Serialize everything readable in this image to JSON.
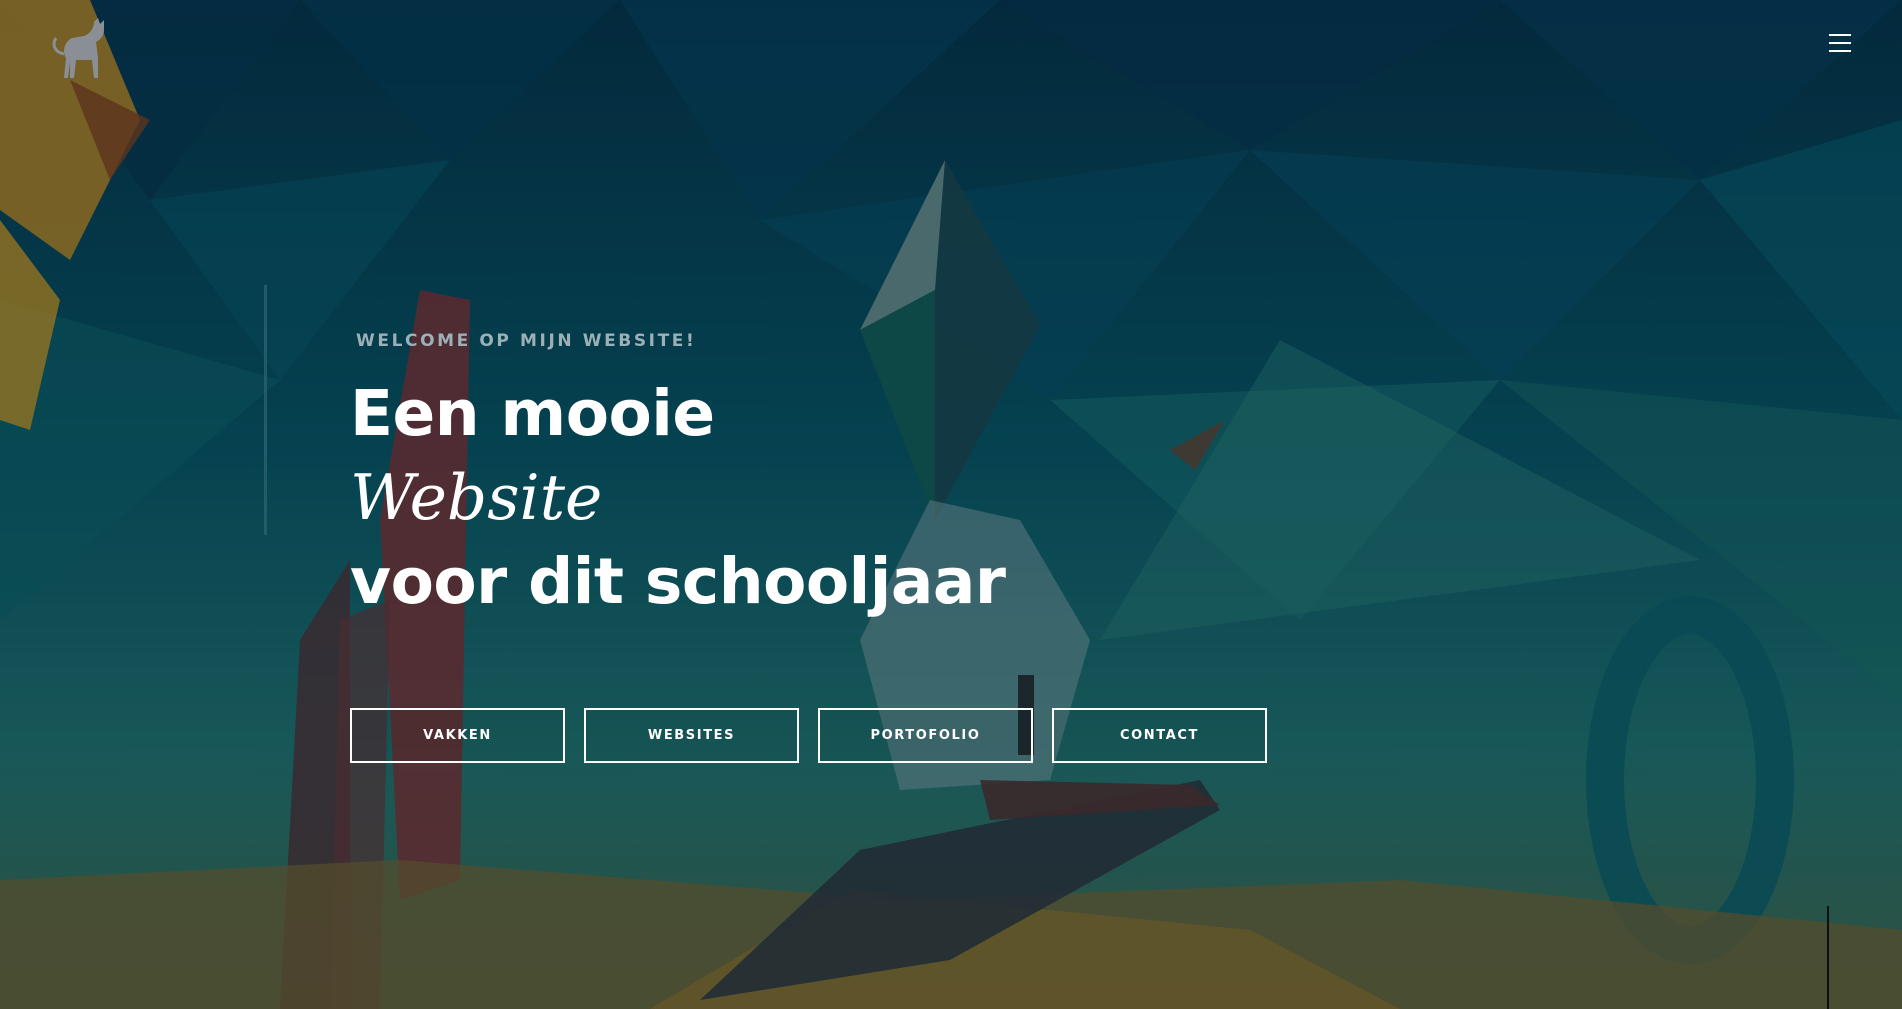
{
  "header": {
    "logo_icon": "cat-logo-icon",
    "menu_icon": "hamburger-menu-icon"
  },
  "hero": {
    "eyebrow": "WELCOME OP MIJN WEBSITE!",
    "title_line1": "Een mooie",
    "title_line2": "Website",
    "title_line3": "voor dit schooljaar"
  },
  "buttons": {
    "vakken": "VAKKEN",
    "websites": "WEBSITES",
    "portofolio": "PORTOFOLIO",
    "contact": "CONTACT"
  },
  "colors": {
    "background_teal": "#063a4f",
    "text_white": "#ffffff",
    "eyebrow_gray": "#9cb0b7"
  }
}
